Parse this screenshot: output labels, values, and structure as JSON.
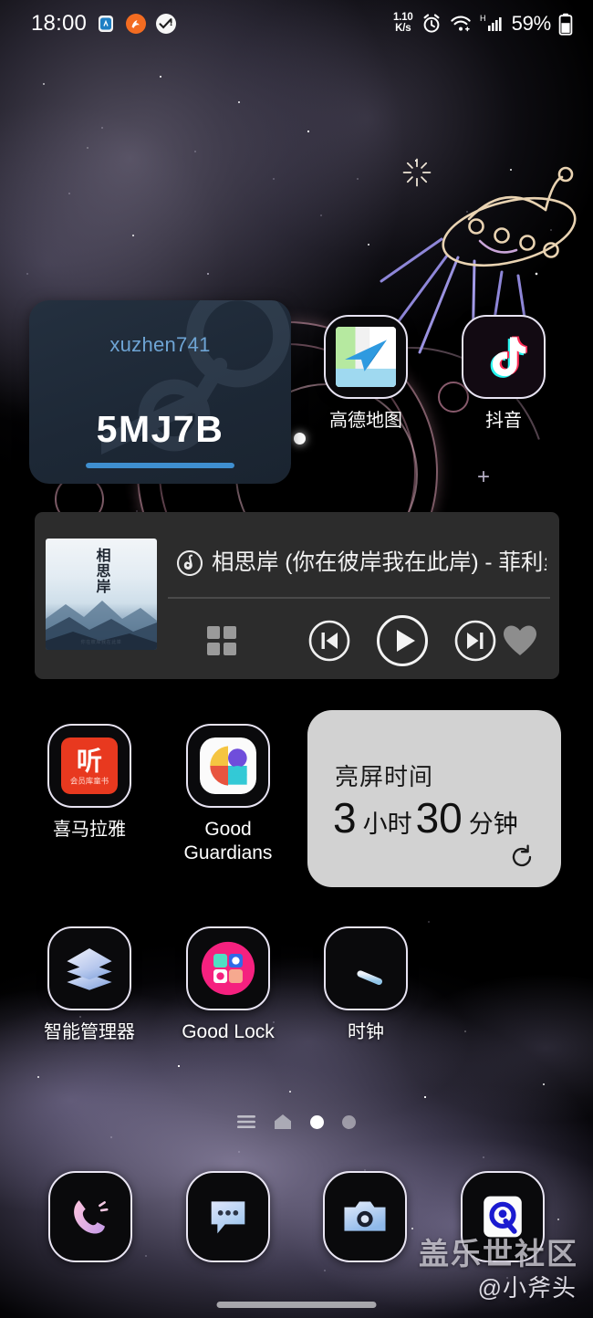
{
  "status_bar": {
    "time": "18:00",
    "left_icons": [
      "smartwatch-icon",
      "mi-fit-icon",
      "task-check-icon"
    ],
    "net_speed_value": "1.10",
    "net_speed_unit": "K/s",
    "right_icons": [
      "alarm-icon",
      "wifi-icon",
      "signal-h-icon"
    ],
    "signal_type": "H",
    "battery_percent": "59%"
  },
  "steam_widget": {
    "username": "xuzhen741",
    "code": "5MJ7B",
    "progress_percent": 100,
    "accent_color": "#3f8fd0",
    "background_color": "#1d2836"
  },
  "music_widget": {
    "source_icon": "netease-cloud-music-icon",
    "track_title": "相思岸 (你在彼岸我在此岸) - 菲利丝...",
    "album_art_title": "相思岸",
    "album_art_caption": "你在彼岸我在此岸",
    "controls": [
      "playlist-grid",
      "previous-track",
      "play",
      "next-track",
      "favorite"
    ],
    "is_playing": false,
    "background_color": "#2c2c2c"
  },
  "screen_time_widget": {
    "title": "亮屏时间",
    "hours_value": "3",
    "hours_unit": "小时",
    "minutes_value": "30",
    "minutes_unit": "分钟",
    "refresh_icon": "refresh-icon",
    "background_color": "#e2e2e2"
  },
  "apps": {
    "row1": [
      {
        "label": "高德地图",
        "icon": "amap-icon"
      },
      {
        "label": "抖音",
        "icon": "douyin-tiktok-icon"
      }
    ],
    "row2": [
      {
        "label": "喜马拉雅",
        "icon": "ximalaya-icon"
      },
      {
        "label": "Good\nGuardians",
        "label_line1": "Good",
        "label_line2": "Guardians",
        "icon": "good-guardians-icon"
      }
    ],
    "row3": [
      {
        "label": "智能管理器",
        "icon": "device-care-icon"
      },
      {
        "label": "Good Lock",
        "icon": "good-lock-icon"
      },
      {
        "label": "时钟",
        "icon": "clock-icon"
      }
    ]
  },
  "page_indicator": {
    "lines_icon": "app-list-icon",
    "home_icon": "home-icon",
    "dots": 2,
    "active_dot": 1
  },
  "dock": [
    {
      "label": "Phone",
      "icon": "phone-icon"
    },
    {
      "label": "Messages",
      "icon": "messages-icon"
    },
    {
      "label": "Camera",
      "icon": "camera-icon"
    },
    {
      "label": "Samsung Members",
      "icon": "samsung-members-icon"
    }
  ],
  "watermark": {
    "community": "盖乐世社区",
    "author": "@小斧头"
  }
}
